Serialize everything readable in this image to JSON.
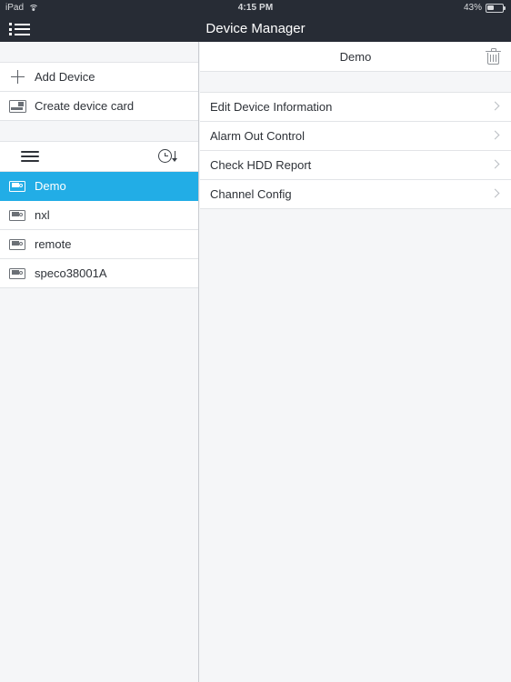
{
  "status_bar": {
    "device_label": "iPad",
    "wifi_icon": "wifi-icon",
    "time": "4:15 PM",
    "battery_percent": "43%",
    "battery_level": 43
  },
  "navbar": {
    "menu_icon": "list-bullet-icon",
    "title": "Device Manager"
  },
  "sidebar": {
    "actions": [
      {
        "label": "Add Device",
        "icon": "plus-icon"
      },
      {
        "label": "Create device card",
        "icon": "device-card-icon"
      }
    ],
    "toolbar": {
      "menu_icon": "hamburger-icon",
      "history_icon": "clock-history-icon"
    },
    "devices": [
      {
        "label": "Demo",
        "icon": "dvr-icon",
        "selected": true
      },
      {
        "label": "nxl",
        "icon": "dvr-icon",
        "selected": false
      },
      {
        "label": "remote",
        "icon": "dvr-icon",
        "selected": false
      },
      {
        "label": "speco38001A",
        "icon": "dvr-icon",
        "selected": false
      }
    ]
  },
  "content": {
    "title": "Demo",
    "delete_icon": "trash-icon",
    "menu_items": [
      {
        "label": "Edit Device Information",
        "accessory": "chevron-right-icon"
      },
      {
        "label": "Alarm Out Control",
        "accessory": "chevron-right-icon"
      },
      {
        "label": "Check HDD Report",
        "accessory": "chevron-right-icon"
      },
      {
        "label": "Channel Config",
        "accessory": "chevron-right-icon"
      }
    ]
  },
  "colors": {
    "navbar_bg": "#272c35",
    "selection_blue": "#22ade6",
    "page_bg": "#f5f6f8",
    "row_bg": "#ffffff",
    "separator": "#e2e4e7"
  }
}
